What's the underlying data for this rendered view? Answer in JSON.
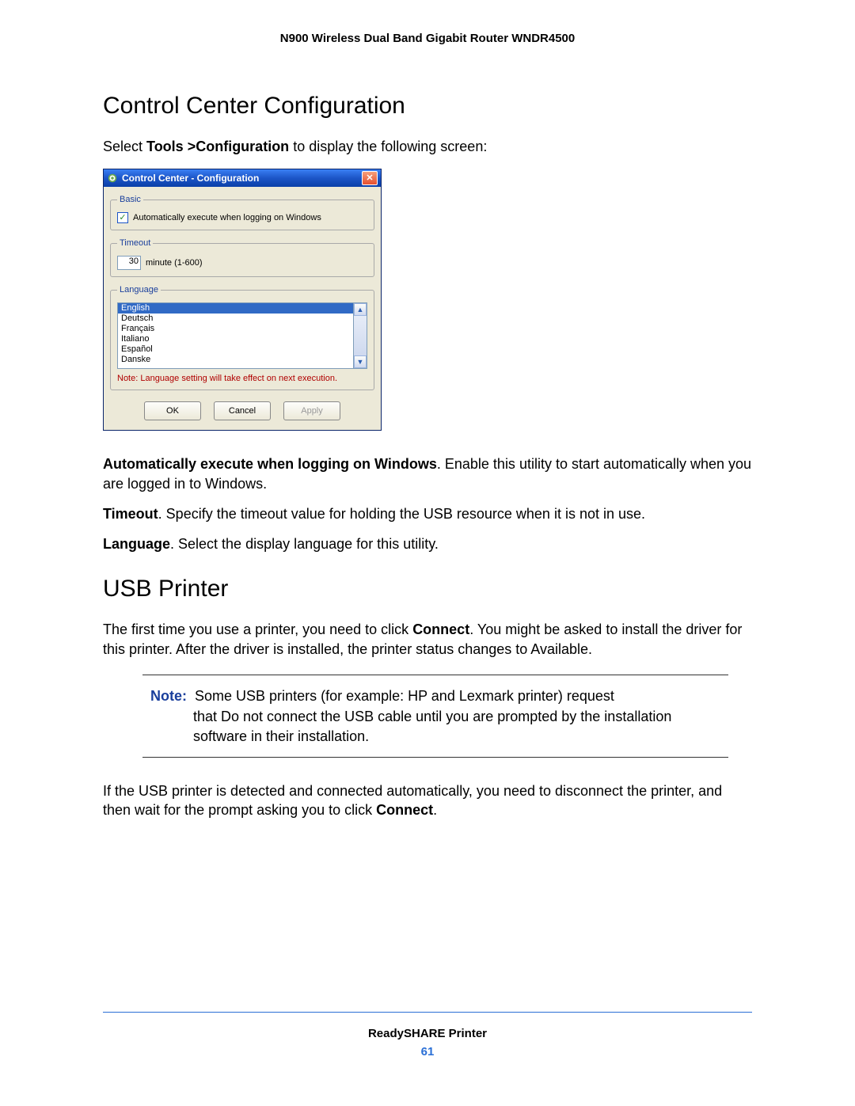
{
  "doc_header": "N900 Wireless Dual Band Gigabit Router WNDR4500",
  "section1": {
    "title": "Control Center Configuration",
    "intro_1": "Select ",
    "intro_bold": "Tools >Configuration",
    "intro_2": " to display the following screen:",
    "auto_label": "Automatically execute when logging on Windows",
    "auto_desc": ". Enable this utility to start automatically when you are logged in to Windows.",
    "timeout_label": "Timeout",
    "timeout_desc": ". Specify the timeout value for holding the USB resource when it is not in use.",
    "language_label": "Language",
    "language_desc": ". Select the display language for this utility."
  },
  "dialog": {
    "title": "Control Center - Configuration",
    "groups": {
      "basic": "Basic",
      "timeout": "Timeout",
      "language": "Language"
    },
    "auto_execute_label": "Automatically execute when logging on Windows",
    "timeout_value": "30",
    "timeout_unit": "minute (1-600)",
    "languages": [
      "English",
      "Deutsch",
      "Français",
      "Italiano",
      "Español",
      "Danske"
    ],
    "language_note": "Note: Language setting will take effect on next execution.",
    "buttons": {
      "ok": "OK",
      "cancel": "Cancel",
      "apply": "Apply"
    }
  },
  "section2": {
    "title": "USB Printer",
    "p1_a": "The first time you use a printer, you need to click ",
    "p1_bold": "Connect",
    "p1_b": ". You might be asked to install the driver for this printer. After the driver is installed, the printer status changes to Available.",
    "note_label": "Note:",
    "note_text_1": "Some USB printers (for example: HP and Lexmark printer) request",
    "note_text_2": "that Do not connect the USB cable until you are prompted by the installation software in their installation.",
    "p2_a": "If the USB printer is detected and connected automatically, you need to disconnect the printer, and then wait for the prompt asking you to click ",
    "p2_bold": "Connect",
    "p2_b": "."
  },
  "footer": {
    "title": "ReadySHARE Printer",
    "page": "61"
  }
}
